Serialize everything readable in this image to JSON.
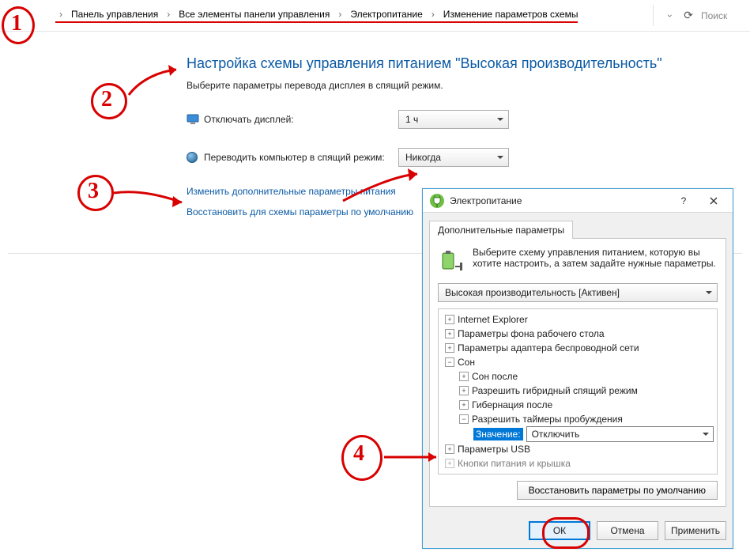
{
  "breadcrumbs": {
    "crumb1": "Панель управления",
    "crumb2": "Все элементы панели управления",
    "crumb3": "Электропитание",
    "crumb4": "Изменение параметров схемы"
  },
  "search_placeholder": "Поиск",
  "heading": "Настройка схемы управления питанием \"Высокая производительность\"",
  "subtext": "Выберите параметры перевода дисплея в спящий режим.",
  "row_display_label": "Отключать дисплей:",
  "row_display_value": "1 ч",
  "row_sleep_label": "Переводить компьютер в спящий режим:",
  "row_sleep_value": "Никогда",
  "link_advanced": "Изменить дополнительные параметры питания",
  "link_restore": "Восстановить для схемы параметры по умолчанию",
  "dialog": {
    "title": "Электропитание",
    "tab": "Дополнительные параметры",
    "intro": "Выберите схему управления питанием, которую вы хотите настроить, а затем задайте нужные параметры.",
    "scheme": "Высокая производительность [Активен]",
    "tree": {
      "ie": "Internet Explorer",
      "bg": "Параметры фона рабочего стола",
      "wifi": "Параметры адаптера беспроводной сети",
      "sleep": "Сон",
      "sleep_after": "Сон после",
      "hybrid": "Разрешить гибридный спящий режим",
      "hibernate": "Гибернация после",
      "wake": "Разрешить таймеры пробуждения",
      "value_label": "Значение:",
      "value_sel": "Отключить",
      "usb": "Параметры USB",
      "lid": "Кнопки питания и крышка"
    },
    "restore_defaults": "Восстановить параметры по умолчанию",
    "ok": "ОК",
    "cancel": "Отмена",
    "apply": "Применить"
  },
  "annotations": {
    "n1": "1",
    "n2": "2",
    "n3": "3",
    "n4": "4"
  }
}
